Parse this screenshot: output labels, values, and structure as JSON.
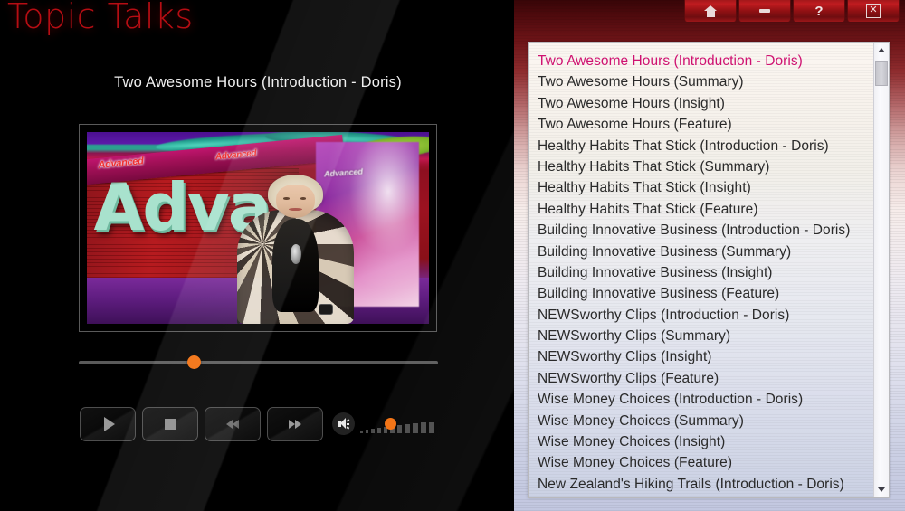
{
  "app": {
    "title": "Topic Talks"
  },
  "player": {
    "now_playing_title": "Two Awesome Hours (Introduction - Doris)",
    "progress_percent": 32,
    "volume_percent": 30,
    "video_still": {
      "set_banner_text_1": "Advanced",
      "set_banner_text_2": "Advanced",
      "set_wall_text": "Adva",
      "set_panel_text": "Advanced"
    },
    "controls": [
      {
        "name": "play-button",
        "icon": "play-icon",
        "label": "Play"
      },
      {
        "name": "stop-button",
        "icon": "stop-icon",
        "label": "Stop"
      },
      {
        "name": "rewind-button",
        "icon": "rewind-icon",
        "label": "Rewind"
      },
      {
        "name": "fast-forward-button",
        "icon": "fast-forward-icon",
        "label": "Fast Forward"
      }
    ],
    "volume_icon": "speaker-icon"
  },
  "window_controls": [
    {
      "name": "home-button",
      "icon": "home-icon",
      "label": "Home"
    },
    {
      "name": "minimize-button",
      "icon": "minimize-icon",
      "label": "Minimize"
    },
    {
      "name": "help-button",
      "icon": "question-mark-icon",
      "label": "?"
    },
    {
      "name": "close-button",
      "icon": "close-icon",
      "label": "☒"
    }
  ],
  "playlist": {
    "selected_index": 0,
    "items": [
      "Two Awesome Hours (Introduction - Doris)",
      "Two Awesome Hours (Summary)",
      "Two Awesome Hours (Insight)",
      "Two Awesome Hours (Feature)",
      "Healthy Habits That Stick (Introduction - Doris)",
      "Healthy Habits That Stick (Summary)",
      "Healthy Habits That Stick (Insight)",
      "Healthy Habits That Stick (Feature)",
      "Building Innovative Business (Introduction - Doris)",
      "Building Innovative Business (Summary)",
      "Building Innovative Business (Insight)",
      "Building Innovative Business (Feature)",
      "NEWSworthy Clips (Introduction - Doris)",
      "NEWSworthy Clips (Summary)",
      "NEWSworthy Clips (Insight)",
      "NEWSworthy Clips (Feature)",
      "Wise Money Choices (Introduction - Doris)",
      "Wise Money Choices (Summary)",
      "Wise Money Choices (Insight)",
      "Wise Money Choices (Feature)",
      "New Zealand's Hiking Trails (Introduction - Doris)"
    ]
  },
  "colors": {
    "accent_orange": "#f36f0c",
    "selected_text": "#cf1271",
    "brand_red": "#b60d13",
    "panel_red": "#8f1013"
  }
}
